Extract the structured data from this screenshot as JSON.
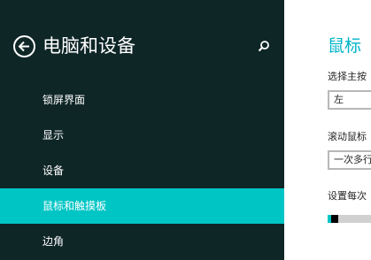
{
  "nav": {
    "title": "电脑和设备",
    "items": [
      {
        "label": "锁屏界面",
        "selected": false
      },
      {
        "label": "显示",
        "selected": false
      },
      {
        "label": "设备",
        "selected": false
      },
      {
        "label": "鼠标和触摸板",
        "selected": true
      },
      {
        "label": "边角",
        "selected": false
      }
    ],
    "back_icon": "back-arrow-icon",
    "search_icon": "search-icon"
  },
  "content": {
    "title": "鼠标",
    "primary_button": {
      "label": "选择主按",
      "value": "左"
    },
    "scroll": {
      "label": "滚动鼠标",
      "value": "一次多行"
    },
    "scroll_lines": {
      "label": "设置每次",
      "fraction": 0.04
    }
  },
  "colors": {
    "nav_background": "#0f2627",
    "accent": "#00c5c5",
    "title_accent": "#00b4c8"
  }
}
